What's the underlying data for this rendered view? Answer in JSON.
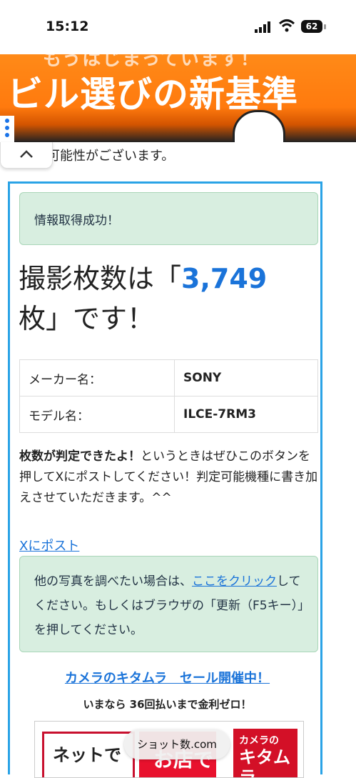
{
  "status_bar": {
    "time": "15:12",
    "battery": "62"
  },
  "ad_banner": {
    "subtitle": "もうはじまっています！",
    "title": "ビル選びの新基準"
  },
  "partial_text": "可能性がございます。",
  "result": {
    "success_message": "情報取得成功！",
    "headline_prefix": "撮影枚数は「",
    "count": "3,749",
    "headline_suffix": "枚」です！"
  },
  "info_table": [
    {
      "label": "メーカー名：",
      "value": "SONY"
    },
    {
      "label": "モデル名：",
      "value": "ILCE-7RM3"
    }
  ],
  "note": {
    "bold": "枚数が判定できたよ！",
    "text": "というときはぜひこのボタンを押してXにポストしてください！判定可能機種に書き加えさせていただきます。^^"
  },
  "x_post_link": "Xにポスト",
  "refresh": {
    "prefix": "他の写真を調べたい場合は、",
    "link": "ここをクリック",
    "suffix": "してください。もしくはブラウザの「更新（F5キー）」を押してください。"
  },
  "promo": {
    "link": "カメラのキタムラ　セール開催中！",
    "subtitle": "いまなら 36回払いまで金利ゼロ！"
  },
  "ad_lower": {
    "left": "ネットで",
    "middle": "お店で",
    "brand_small": "カメラの",
    "brand_big": "キタムラ"
  },
  "site_pill": "ショット数.com"
}
